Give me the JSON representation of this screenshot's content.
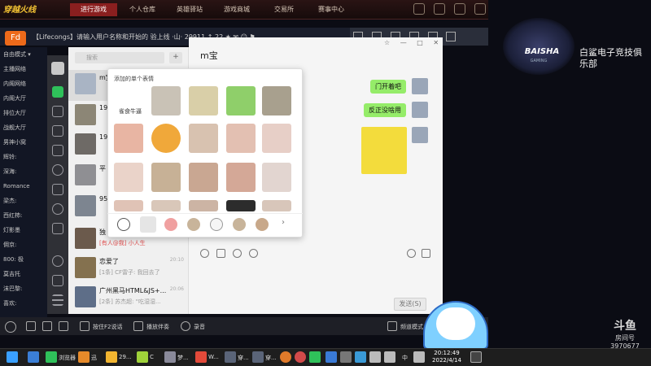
{
  "game": {
    "logo": "穿越火线",
    "tabs": [
      "进行游戏",
      "个人仓库",
      "英雄驿站",
      "游戏商城",
      "交易所",
      "赛事中心"
    ]
  },
  "room": {
    "icon": "Fd",
    "title": "【Lifecongs】请输入用户名称和开始的 验上线 ·山·  29911  ↑ 22  ★ ✉ ☺ ⚑"
  },
  "channels": [
    "自由模式 ▾",
    "主播网络",
    "内阁网络",
    "内阁大厅",
    "排位大厅",
    "战舰大厅",
    "男神小窝",
    "辉铃:",
    "深海:",
    "Romance",
    "梁杰:",
    "西红柿:",
    "灯影墨",
    "佣京:",
    "800: 极",
    "莫吉托",
    "沫巴黎:",
    "喜欢:"
  ],
  "contacts": {
    "search_placeholder": "搜索",
    "add_label": "+",
    "items": [
      {
        "name": "m宝",
        "sub": "",
        "time": ""
      },
      {
        "name": "19",
        "sub": "",
        "time": ""
      },
      {
        "name": "19",
        "sub": "",
        "time": ""
      },
      {
        "name": "平",
        "sub": "",
        "time": ""
      },
      {
        "name": "95",
        "sub": "",
        "time": ""
      },
      {
        "name": "独",
        "sub": "[有人@我] 小人生",
        "time": ""
      },
      {
        "name": "恋爱了",
        "sub": "[1条] CF雷子: 我回去了",
        "time": "20:10"
      },
      {
        "name": "广州黑马HTML&JS+...",
        "sub": "[2条] 苏杰超: \"吃湿湿...",
        "time": "20:06"
      }
    ]
  },
  "chat": {
    "title": "m宝",
    "window_controls": [
      "☆",
      "—",
      "□",
      "✕"
    ],
    "messages": [
      "门开着吧",
      "反正没啥用"
    ],
    "send_label": "发送(S)"
  },
  "emoji_popup": {
    "header": "添加的单个表情",
    "first_label": "雀食牛逼"
  },
  "voice_bar": {
    "f2_label": "按住F2说话",
    "play_label": "播放伴奏",
    "record_label": "录音",
    "channel_mode": "频道模式"
  },
  "overlay": {
    "shark_text": "BAISHA",
    "shark_sub": "GAMING",
    "club_name": "白鲨电子竞技俱乐部",
    "platform": "斗鱼",
    "room_label": "房间号",
    "room_no": "3970677"
  },
  "taskbar": {
    "apps": [
      "浏览器",
      "迅",
      "29...",
      "C",
      "梦...",
      "W...",
      "穿...",
      "穿..."
    ],
    "time": "20:12:49",
    "date": "2022/4/14",
    "ime": "中"
  }
}
